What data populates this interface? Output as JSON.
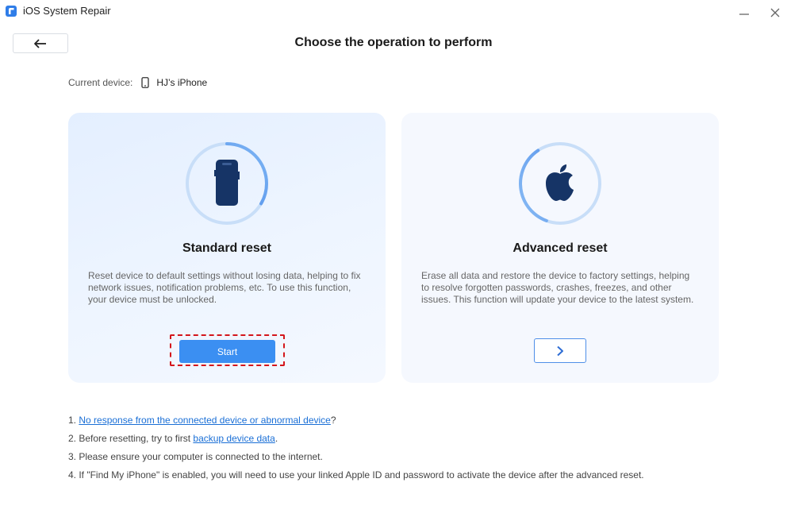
{
  "app": {
    "title": "iOS System Repair"
  },
  "header": {
    "title": "Choose the operation to perform"
  },
  "device": {
    "label": "Current device:",
    "name": "HJ’s iPhone"
  },
  "cards": {
    "standard": {
      "title": "Standard reset",
      "description": "Reset device to default settings without losing data, helping to fix network issues, notification problems, etc. To use this function, your device must be unlocked.",
      "button_label": "Start"
    },
    "advanced": {
      "title": "Advanced reset",
      "description": "Erase all data and restore the device to factory settings, helping to resolve forgotten passwords, crashes, freezes, and other issues. This function will update your device to the latest system."
    }
  },
  "notes": {
    "n1": {
      "prefix": "1. ",
      "link": "No response from the connected device or abnormal device",
      "suffix": "?"
    },
    "n2": {
      "prefix": "2. Before resetting, try to first ",
      "link": "backup device data",
      "suffix": "."
    },
    "n3": {
      "text": "3. Please ensure your computer is connected to the internet."
    },
    "n4": {
      "text": "4. If \"Find My iPhone\" is enabled, you will need to use your linked Apple ID and password to activate the device after the advanced reset."
    }
  },
  "icons": {
    "app_logo": "app-logo-icon",
    "minimize": "minimize-icon",
    "close": "close-icon",
    "back": "arrow-left-icon",
    "device": "phone-icon",
    "standard": "iphone-icon",
    "advanced": "apple-logo-icon",
    "next": "chevron-right-icon"
  },
  "colors": {
    "accent": "#3b8ff2",
    "link": "#1a6fd6",
    "highlight_frame": "#d4161c",
    "icon_dark": "#163466"
  }
}
